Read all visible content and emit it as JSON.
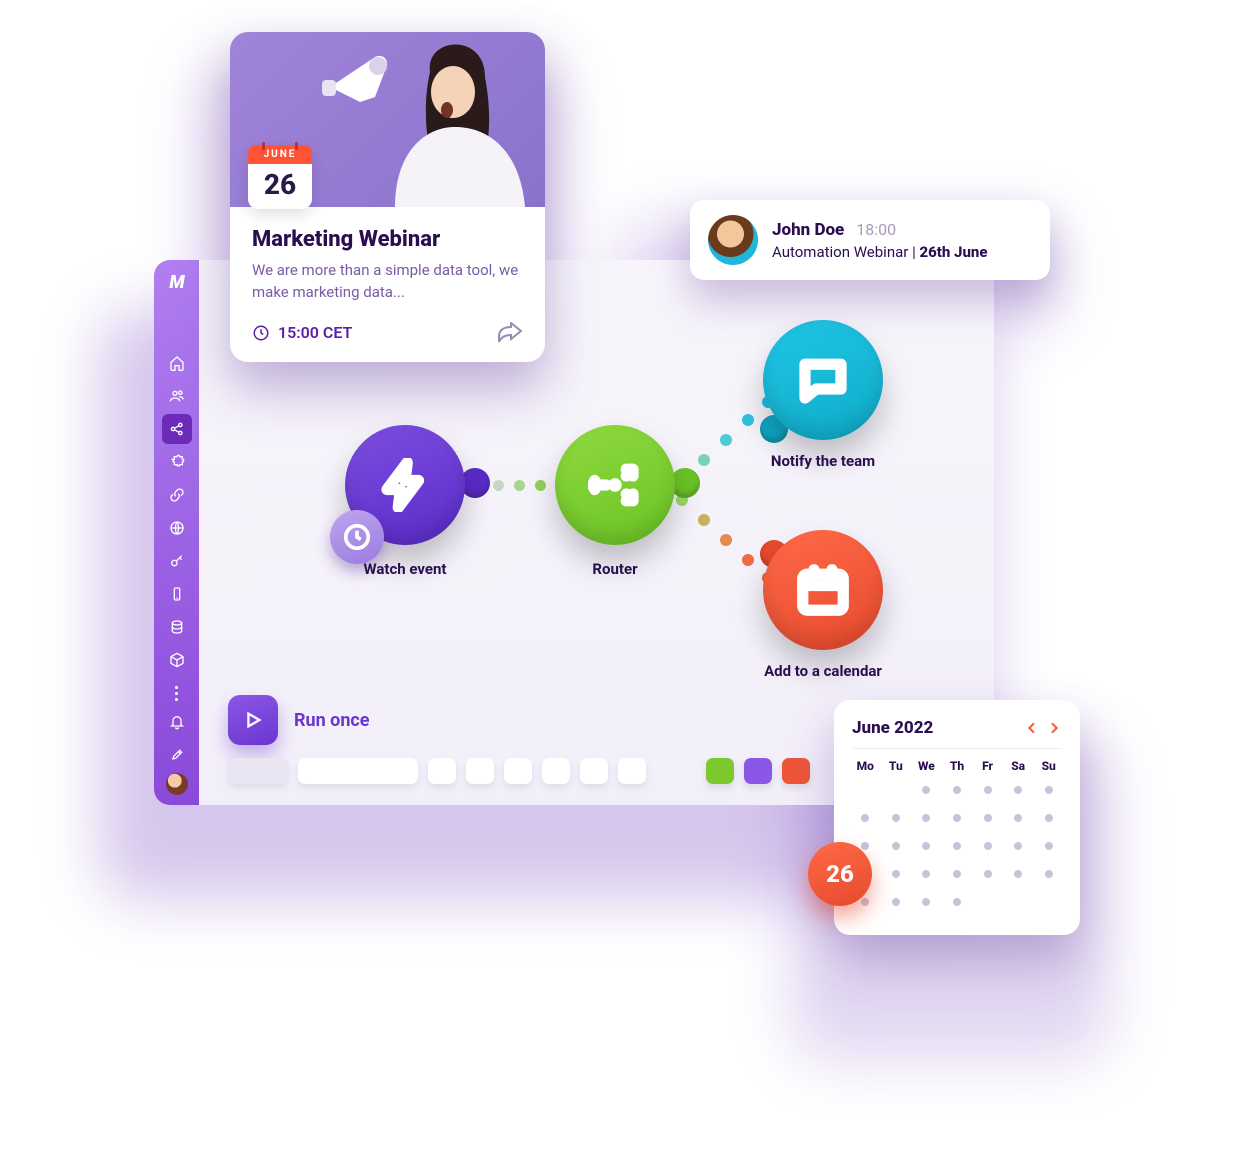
{
  "colors": {
    "purple": "#6a36cf",
    "green": "#7cc92e",
    "cyan": "#18bfdd",
    "orange": "#ef5638"
  },
  "sidebar": {
    "logo": "M",
    "items": [
      "home",
      "users",
      "share",
      "puzzle",
      "link",
      "globe",
      "key",
      "mobile",
      "database",
      "cube"
    ],
    "active_index": 2
  },
  "event_card": {
    "badge_month": "JUNE",
    "badge_day": "26",
    "title": "Marketing Webinar",
    "description": "We are more than a simple data tool, we make marketing data...",
    "time": "15:00 CET"
  },
  "notification": {
    "name": "John Doe",
    "time": "18:00",
    "subject_prefix": "Automation Webinar | ",
    "subject_bold": "26th June"
  },
  "flow": {
    "watch_label": "Watch event",
    "router_label": "Router",
    "notify_label": "Notify the team",
    "calendar_label": "Add to a calendar"
  },
  "run": {
    "label": "Run once"
  },
  "timeline_chips": [
    "#7cc92e",
    "#8a57e6",
    "#ef5638"
  ],
  "calendar": {
    "title": "June 2022",
    "day_headers": [
      "Mo",
      "Tu",
      "We",
      "Th",
      "Fr",
      "Sa",
      "Su"
    ],
    "leading_blanks": 2,
    "days": 30,
    "highlight_day": "26"
  }
}
